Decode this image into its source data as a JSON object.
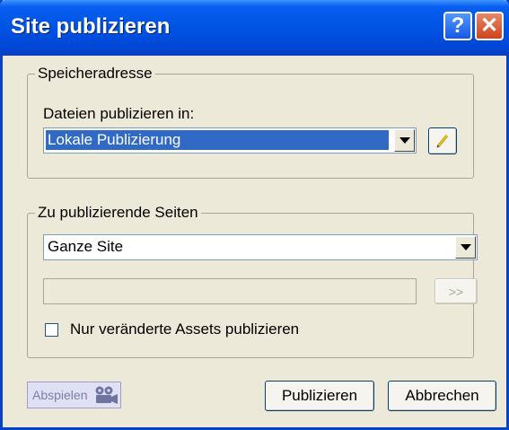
{
  "window": {
    "title": "Site publizieren",
    "help_glyph": "?",
    "close_glyph": "✕"
  },
  "location": {
    "group_label": "Speicheradresse",
    "field_label": "Dateien publizieren in:",
    "selected": "Lokale Publizierung",
    "edit_icon": "pencil-icon"
  },
  "pages": {
    "group_label": "Zu publizierende Seiten",
    "selected": "Ganze Site",
    "path_value": "",
    "browse_label": ">>",
    "checkbox_label": "Nur veränderte Assets publizieren",
    "checkbox_checked": false
  },
  "footer": {
    "play_label": "Abspielen",
    "play_icon": "camera-icon",
    "publish_label": "Publizieren",
    "cancel_label": "Abbrechen"
  },
  "colors": {
    "title_bar": "#0055e5",
    "dialog_bg": "#ece9d8",
    "selection": "#316ac5",
    "close": "#d0421c"
  }
}
